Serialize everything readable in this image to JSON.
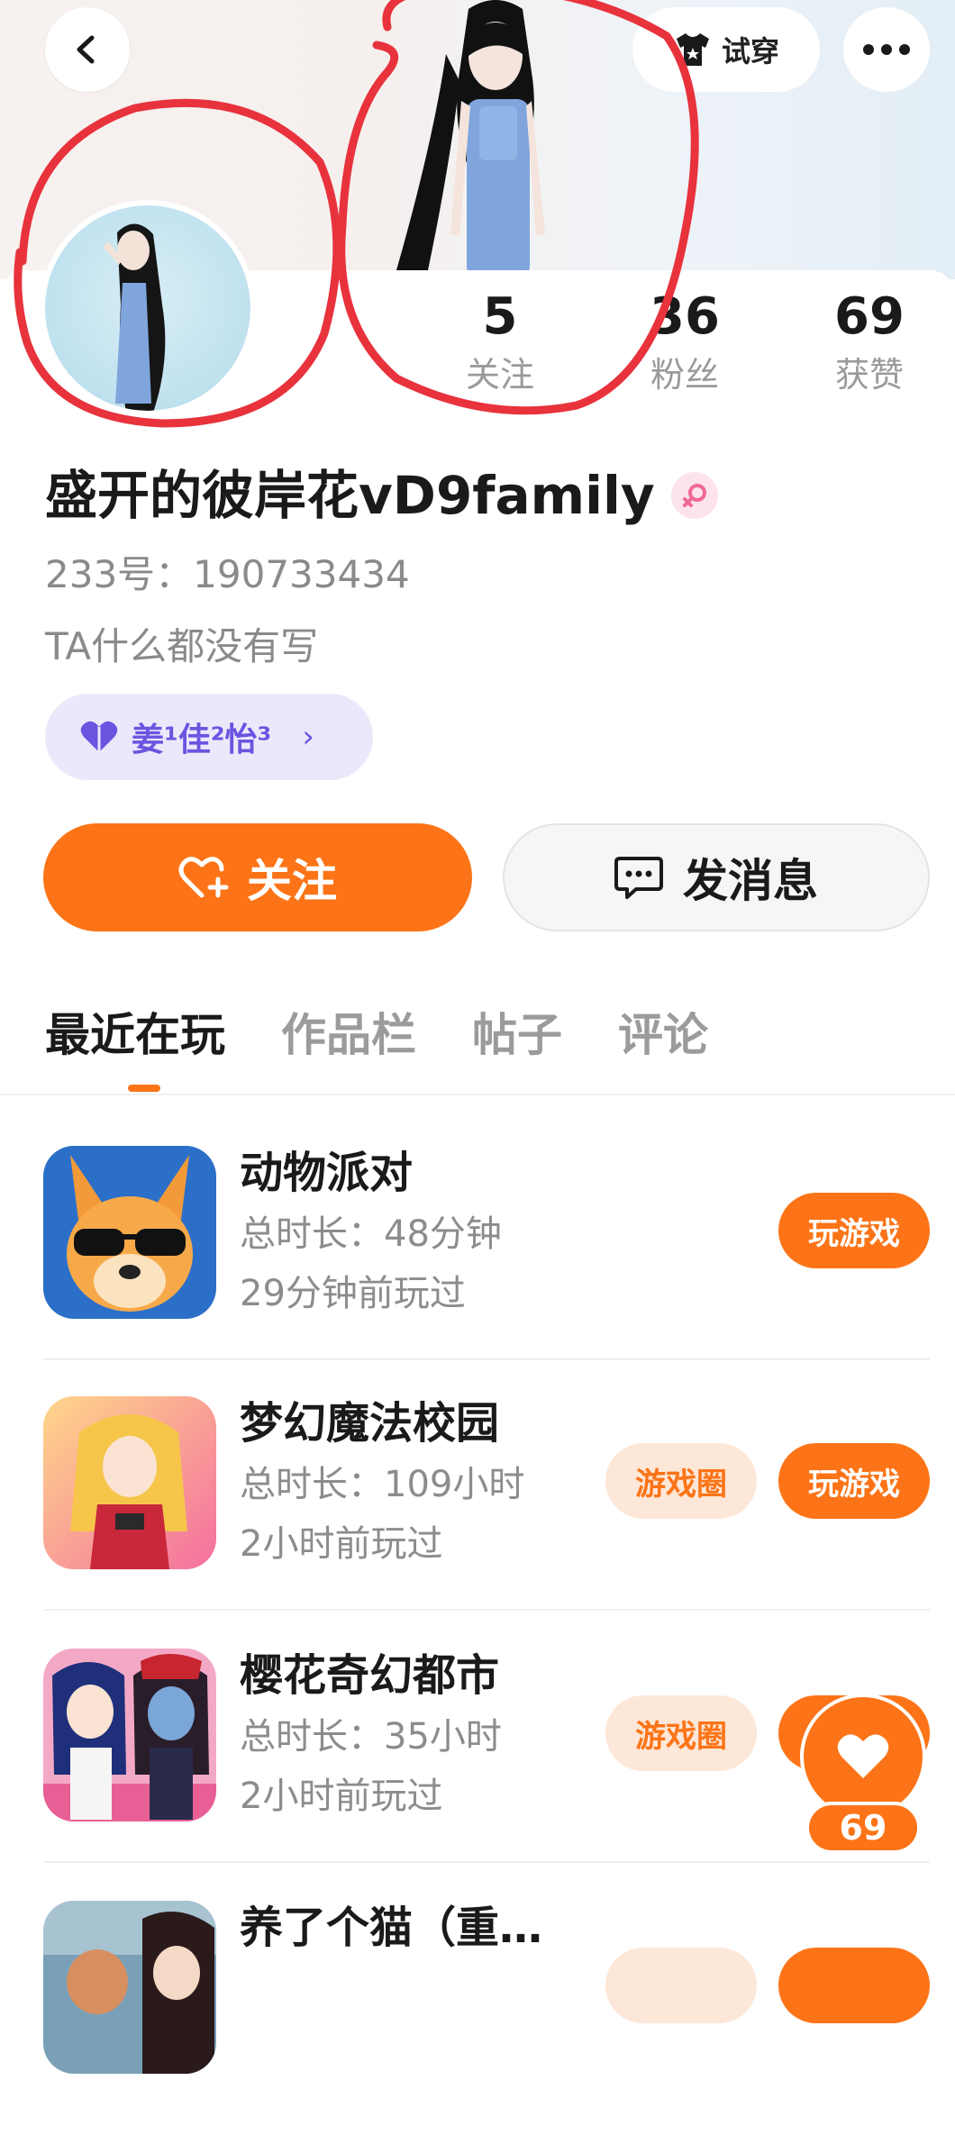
{
  "header": {
    "tryon_label": "试穿",
    "back_icon": "chevron-left-icon",
    "more_icon": "more-dots-icon"
  },
  "stats": [
    {
      "value": "5",
      "label": "关注"
    },
    {
      "value": "36",
      "label": "粉丝"
    },
    {
      "value": "69",
      "label": "获赞"
    }
  ],
  "profile": {
    "nickname": "盛开的彼岸花vD9family",
    "account_id": "233号：190733434",
    "bio": "TA什么都没有写",
    "gender_icon": "female-icon"
  },
  "relation": {
    "name": "姜¹佳²怡³",
    "icon": "heart-icon"
  },
  "actions": {
    "follow_label": "关注",
    "message_label": "发消息"
  },
  "tabs": [
    {
      "label": "最近在玩",
      "active": true
    },
    {
      "label": "作品栏",
      "active": false
    },
    {
      "label": "帖子",
      "active": false
    },
    {
      "label": "评论",
      "active": false
    }
  ],
  "games": [
    {
      "name": "动物派对",
      "total_time": "总时长：48分钟",
      "last_played": "29分钟前玩过",
      "circle_label": "",
      "play_label": "玩游戏"
    },
    {
      "name": "梦幻魔法校园",
      "total_time": "总时长：109小时",
      "last_played": "2小时前玩过",
      "circle_label": "游戏圈",
      "play_label": "玩游戏"
    },
    {
      "name": "樱花奇幻都市",
      "total_time": "总时长：35小时",
      "last_played": "2小时前玩过",
      "circle_label": "游戏圈",
      "play_label": ""
    },
    {
      "name": "养了个猫（重…",
      "total_time": "",
      "last_played": "",
      "circle_label": "",
      "play_label": ""
    }
  ],
  "like_float": {
    "count": "69"
  },
  "colors": {
    "accent": "#fc7417",
    "annotation": "#e8323c"
  }
}
